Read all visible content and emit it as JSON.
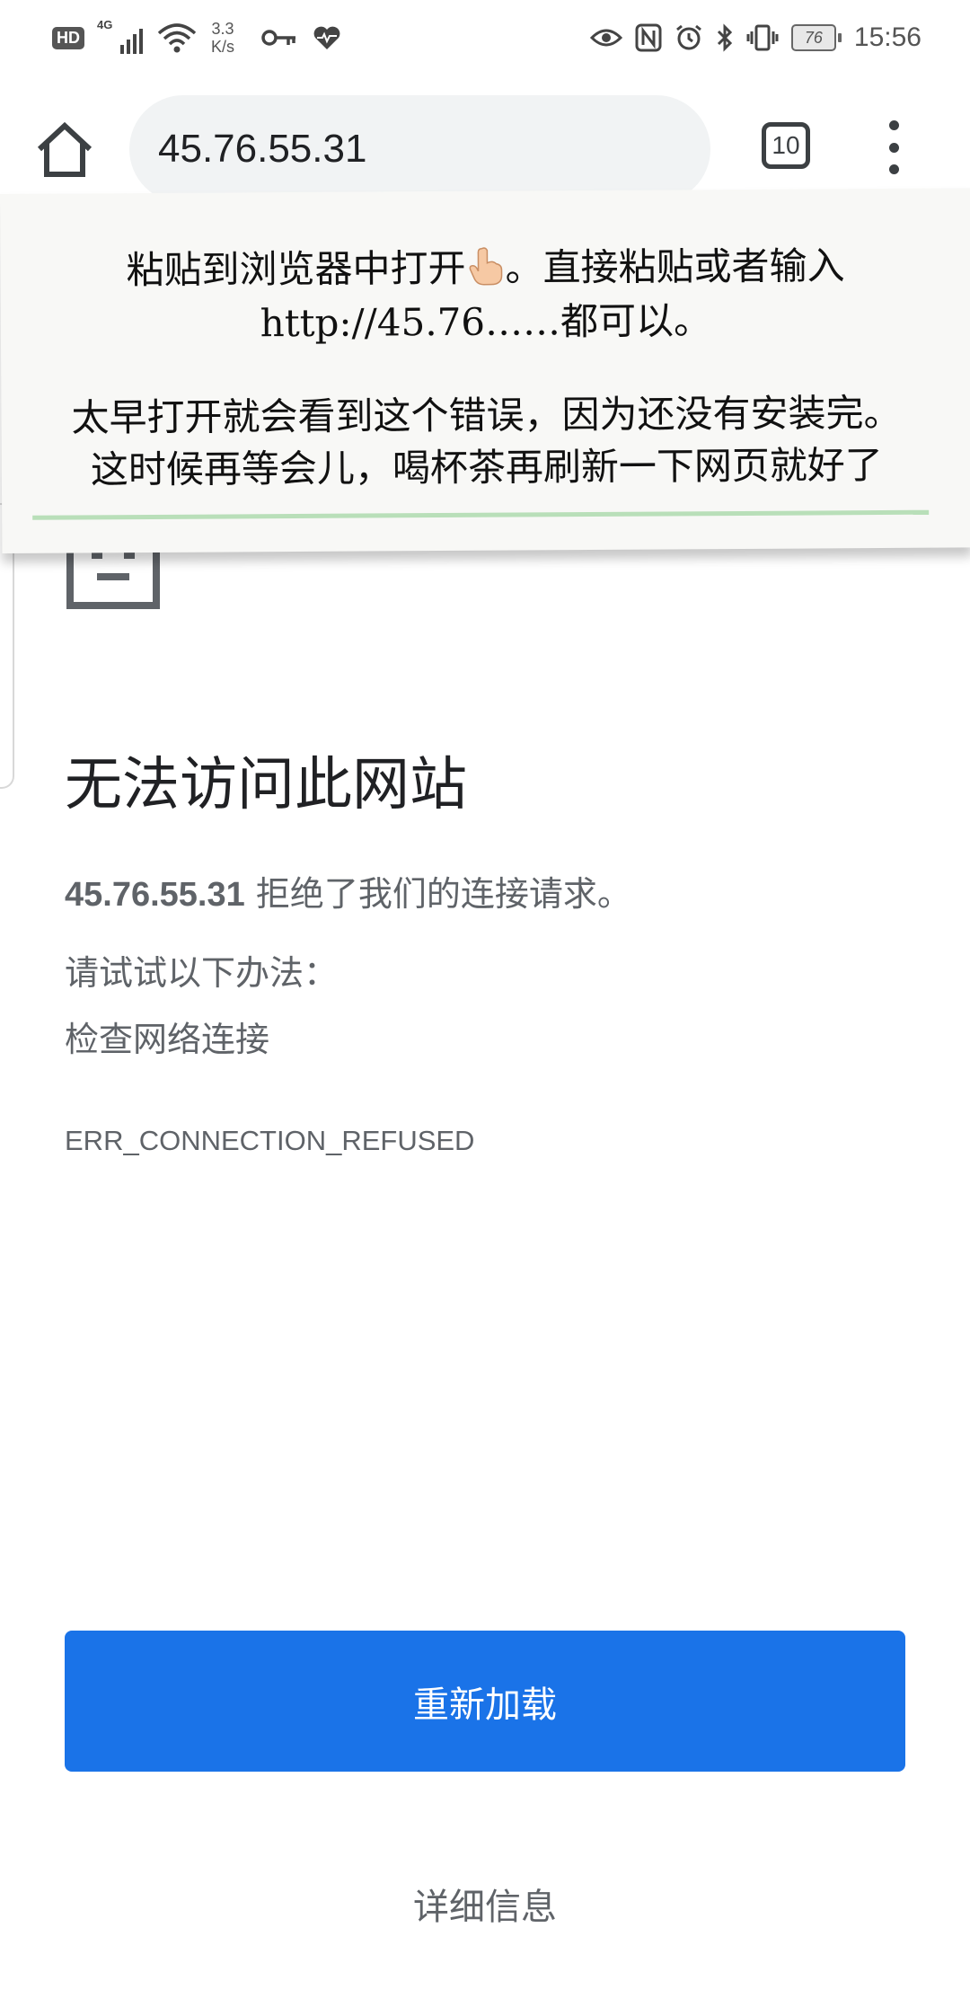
{
  "status_bar": {
    "hd_badge": "HD",
    "signal_label": "4G",
    "net_speed_value": "3.3",
    "net_speed_unit": "K/s",
    "battery_level": "76",
    "time": "15:56",
    "icons": [
      "signal-icon",
      "wifi-icon",
      "key-icon",
      "heart-icon",
      "eye-icon",
      "nfc-icon",
      "alarm-icon",
      "bluetooth-icon",
      "vibrate-icon",
      "battery-icon"
    ]
  },
  "toolbar": {
    "url": "45.76.55.31",
    "tab_count": "10",
    "icons": [
      "home-icon",
      "more-vert-icon"
    ]
  },
  "overlay": {
    "line1_text": "粘贴到浏览器中打开",
    "line1_suffix": "。直接粘贴或者输入",
    "line2": "http://45.76……都可以。",
    "line3": "太早打开就会看到这个错误，因为还没有安装完。",
    "line4": "这时候再等会儿，喝杯茶再刷新一下网页就好了",
    "line_color": "#b9dfb9"
  },
  "error_page": {
    "title": "无法访问此网站",
    "host": "45.76.55.31",
    "message": " 拒绝了我们的连接请求。",
    "try_label": "请试试以下办法：",
    "suggestion": "检查网络连接",
    "error_code": "ERR_CONNECTION_REFUSED",
    "reload_label": "重新加载",
    "details_label": "详细信息",
    "accent_color": "#1a73e8"
  }
}
